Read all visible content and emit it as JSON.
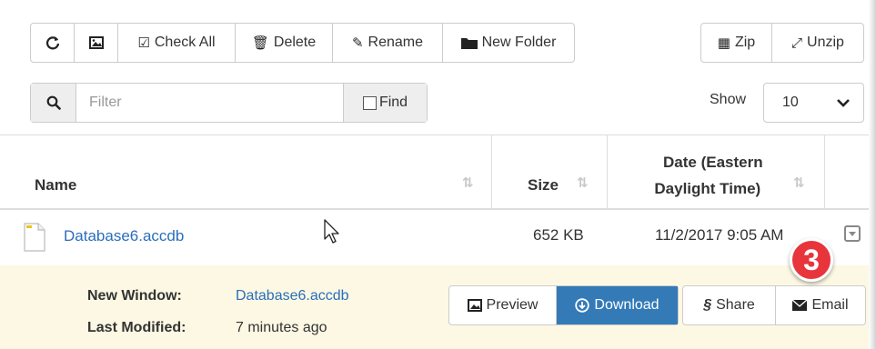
{
  "toolbar": {
    "refresh_icon": "refresh-icon",
    "thumbnail_icon": "image-icon",
    "check_all": "Check All",
    "delete": "Delete",
    "rename": "Rename",
    "new_folder": "New Folder",
    "zip": "Zip",
    "unzip": "Unzip"
  },
  "filter": {
    "placeholder": "Filter",
    "find": "Find"
  },
  "show": {
    "label": "Show",
    "value": "10"
  },
  "table": {
    "headers": {
      "name": "Name",
      "size": "Size",
      "date_line1": "Date (Eastern",
      "date_line2": "Daylight Time)"
    },
    "rows": [
      {
        "name": "Database6.accdb",
        "size": "652 KB",
        "date": "11/2/2017 9:05 AM"
      }
    ]
  },
  "details": {
    "new_window_label": "New Window:",
    "new_window_value": "Database6.accdb",
    "last_modified_label": "Last Modified:",
    "last_modified_value": "7 minutes ago",
    "actions": {
      "preview": "Preview",
      "download": "Download",
      "share": "Share",
      "email": "Email"
    }
  },
  "badge": {
    "number": "3"
  },
  "colors": {
    "link": "#2a6ebb",
    "primary": "#337ab7",
    "detail_bg": "#fcf8e3",
    "badge": "#e8343b"
  }
}
